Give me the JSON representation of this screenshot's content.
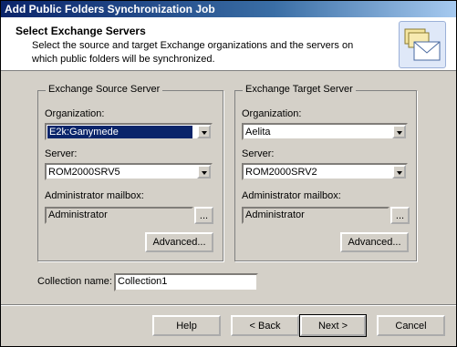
{
  "window": {
    "title": "Add Public Folders Synchronization Job"
  },
  "header": {
    "title": "Select Exchange Servers",
    "description": "Select the source and target Exchange organizations and the servers on which public folders will be synchronized.",
    "icon": "public-folders-mail-icon"
  },
  "source": {
    "legend": "Exchange Source Server",
    "organization_label": "Organization:",
    "organization_value": "E2k:Ganymede",
    "server_label": "Server:",
    "server_value": "ROM2000SRV5",
    "admin_label": "Administrator mailbox:",
    "admin_value": "Administrator",
    "browse_label": "...",
    "advanced_label": "Advanced..."
  },
  "target": {
    "legend": "Exchange Target Server",
    "organization_label": "Organization:",
    "organization_value": "Aelita",
    "server_label": "Server:",
    "server_value": "ROM2000SRV2",
    "admin_label": "Administrator mailbox:",
    "admin_value": "Administrator",
    "browse_label": "...",
    "advanced_label": "Advanced..."
  },
  "collection": {
    "label": "Collection name:",
    "value": "Collection1"
  },
  "buttons": {
    "help": "Help",
    "back": "< Back",
    "next": "Next >",
    "cancel": "Cancel"
  }
}
